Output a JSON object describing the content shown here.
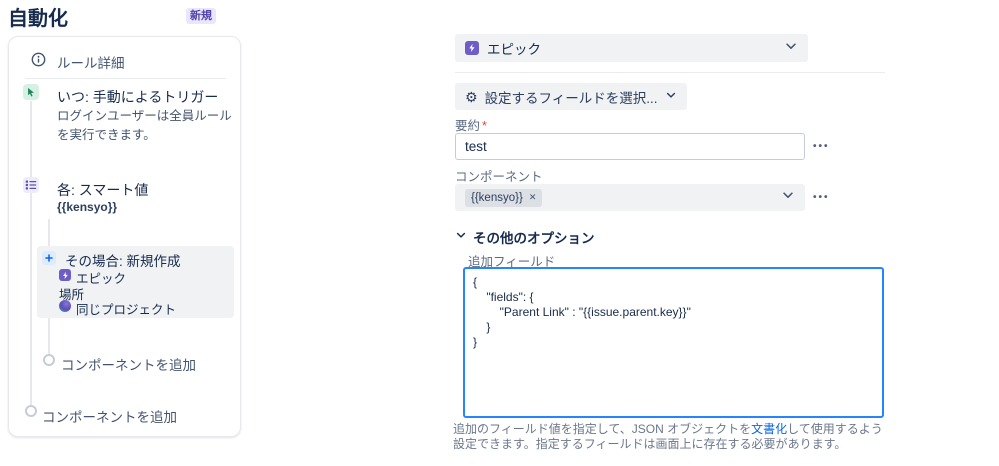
{
  "colors": {
    "epic_purple": "#6E5DC6",
    "badge_bg": "#EAE6FF",
    "badge_text": "#5243AA",
    "trigger_green": "#1F845A",
    "branch_purple": "#5E4DB2",
    "plus_blue": "#0C66E4",
    "focus_border_blue": "#2684FF",
    "link_blue": "#0C66E4",
    "required_red": "#E34935",
    "field_bg_gray": "#F1F2F4"
  },
  "icons": {
    "gear": "⚙"
  },
  "header": {
    "title": "自動化",
    "badge": "新規"
  },
  "sidebar": {
    "rule_details_label": "ルール詳細",
    "trigger_title": "いつ: 手動によるトリガー",
    "trigger_description": "ログインユーザーは全員ルールを実行できます。",
    "branch_title": "各: スマート値",
    "branch_value": "{{kensyo}}",
    "action_title": "その場合: 新規作成",
    "action_issue_type": "エピック",
    "action_location_label": "場所",
    "action_location_value": "同じプロジェクト",
    "add_component_inner": "コンポーネントを追加",
    "add_component_outer": "コンポーネントを追加"
  },
  "editor": {
    "issue_type_value": "エピック",
    "choose_fields_label": "設定するフィールドを選択...",
    "summary_label": "要約",
    "summary_required": "*",
    "summary_value": "test",
    "menu_dots": "•••",
    "components_label": "コンポーネント",
    "components_tag": "{{kensyo}}",
    "components_tag_remove": "✕",
    "more_options_label": "その他のオプション",
    "additional_fields_label": "追加フィールド",
    "additional_fields_value": "{\n    \"fields\": {\n        \"Parent Link\" : \"{{issue.parent.key}}\"\n    }\n}",
    "help_text_before": "追加のフィールド値を指定して、JSON オブジェクトを",
    "help_text_link": "文書化",
    "help_text_after": "して使用するよう設定できます。指定するフィールドは画面上に存在する必要があります。"
  }
}
